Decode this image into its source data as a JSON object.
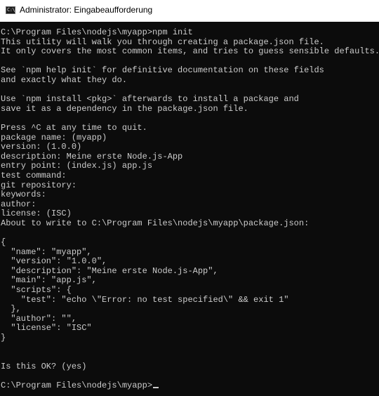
{
  "window": {
    "title": "Administrator: Eingabeaufforderung",
    "icon": "cmd-console-icon",
    "icon_glyph": "C:\\"
  },
  "console": {
    "text_color": "#cccccc",
    "background": "#0c0c0c",
    "lines": [
      "C:\\Program Files\\nodejs\\myapp>npm init",
      "This utility will walk you through creating a package.json file.",
      "It only covers the most common items, and tries to guess sensible defaults.",
      "",
      "See `npm help init` for definitive documentation on these fields",
      "and exactly what they do.",
      "",
      "Use `npm install <pkg>` afterwards to install a package and",
      "save it as a dependency in the package.json file.",
      "",
      "Press ^C at any time to quit.",
      "package name: (myapp)",
      "version: (1.0.0)",
      "description: Meine erste Node.js-App",
      "entry point: (index.js) app.js",
      "test command:",
      "git repository:",
      "keywords:",
      "author:",
      "license: (ISC)",
      "About to write to C:\\Program Files\\nodejs\\myapp\\package.json:",
      "",
      "{",
      "  \"name\": \"myapp\",",
      "  \"version\": \"1.0.0\",",
      "  \"description\": \"Meine erste Node.js-App\",",
      "  \"main\": \"app.js\",",
      "  \"scripts\": {",
      "    \"test\": \"echo \\\"Error: no test specified\\\" && exit 1\"",
      "  },",
      "  \"author\": \"\",",
      "  \"license\": \"ISC\"",
      "}",
      "",
      "",
      "Is this OK? (yes)",
      "",
      "C:\\Program Files\\nodejs\\myapp>"
    ]
  }
}
